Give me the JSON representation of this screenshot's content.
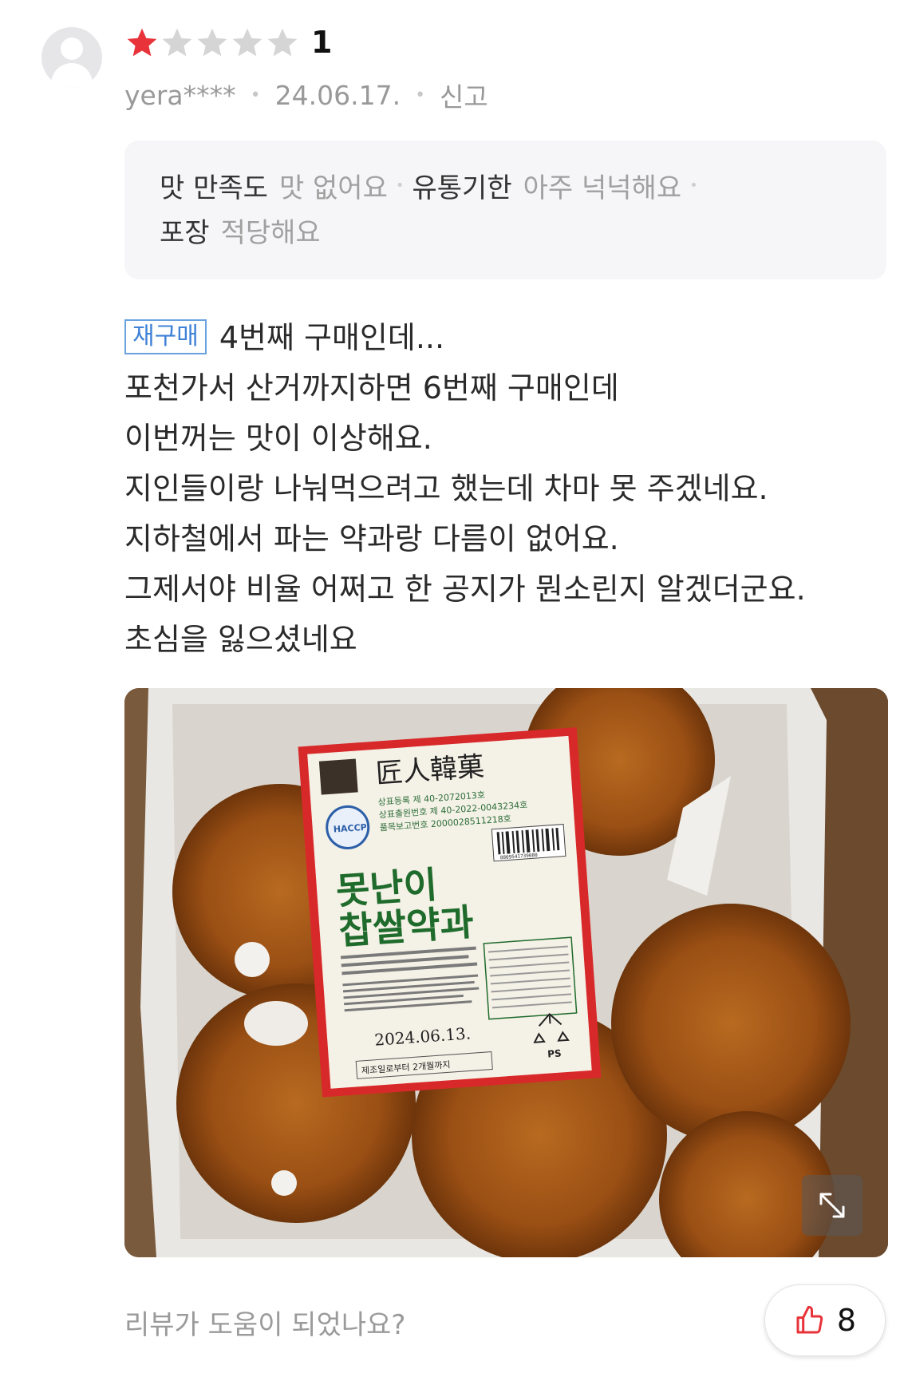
{
  "review": {
    "rating": 1,
    "rating_label": "1",
    "stars_total": 5,
    "star_colors": {
      "filled": "#e8333a",
      "empty": "#d5d5d5"
    },
    "author": "yera****",
    "date": "24.06.17.",
    "report_label": "신고",
    "criteria": {
      "taste_key": "맛 만족도",
      "taste_value": "맛 없어요",
      "expiry_key": "유통기한",
      "expiry_value": "아주 넉넉해요",
      "packaging_key": "포장",
      "packaging_value": "적당해요"
    },
    "repurchase_badge": "재구매",
    "body_lines": [
      "4번째 구매인데...",
      "포천가서 산거까지하면 6번째 구매인데",
      "이번꺼는 맛이 이상해요.",
      "지인들이랑 나눠먹으려고 했는데 차마 못 주겠네요.",
      "지하철에서 파는 약과랑 다름이 없어요.",
      "그제서야 비율 어쩌고 한 공지가 뭔소린지 알겠더군요.",
      "초심을 잃으셨네요"
    ],
    "photo": {
      "label_brand": "匠人韓菓",
      "label_reg_line1": "상표등록 제 40-2072013호",
      "label_reg_line2": "상표출원번호 제 40-2022-0043234호",
      "label_reg_line3": "품목보고번호 2000028511218호",
      "haccp": "HACCP",
      "product_name_line1": "못난이",
      "product_name_line2": "찹쌀약과",
      "mfg_date": "2024.06.13.",
      "best_before": "제조일로부터 2개월까지",
      "recycle": "PS",
      "barcode_number": "8809541739080"
    },
    "helpful_question": "리뷰가 도움이 되었나요?",
    "helpful_count": "8",
    "accent_color": "#e8333a",
    "badge_color": "#3f82d6"
  }
}
